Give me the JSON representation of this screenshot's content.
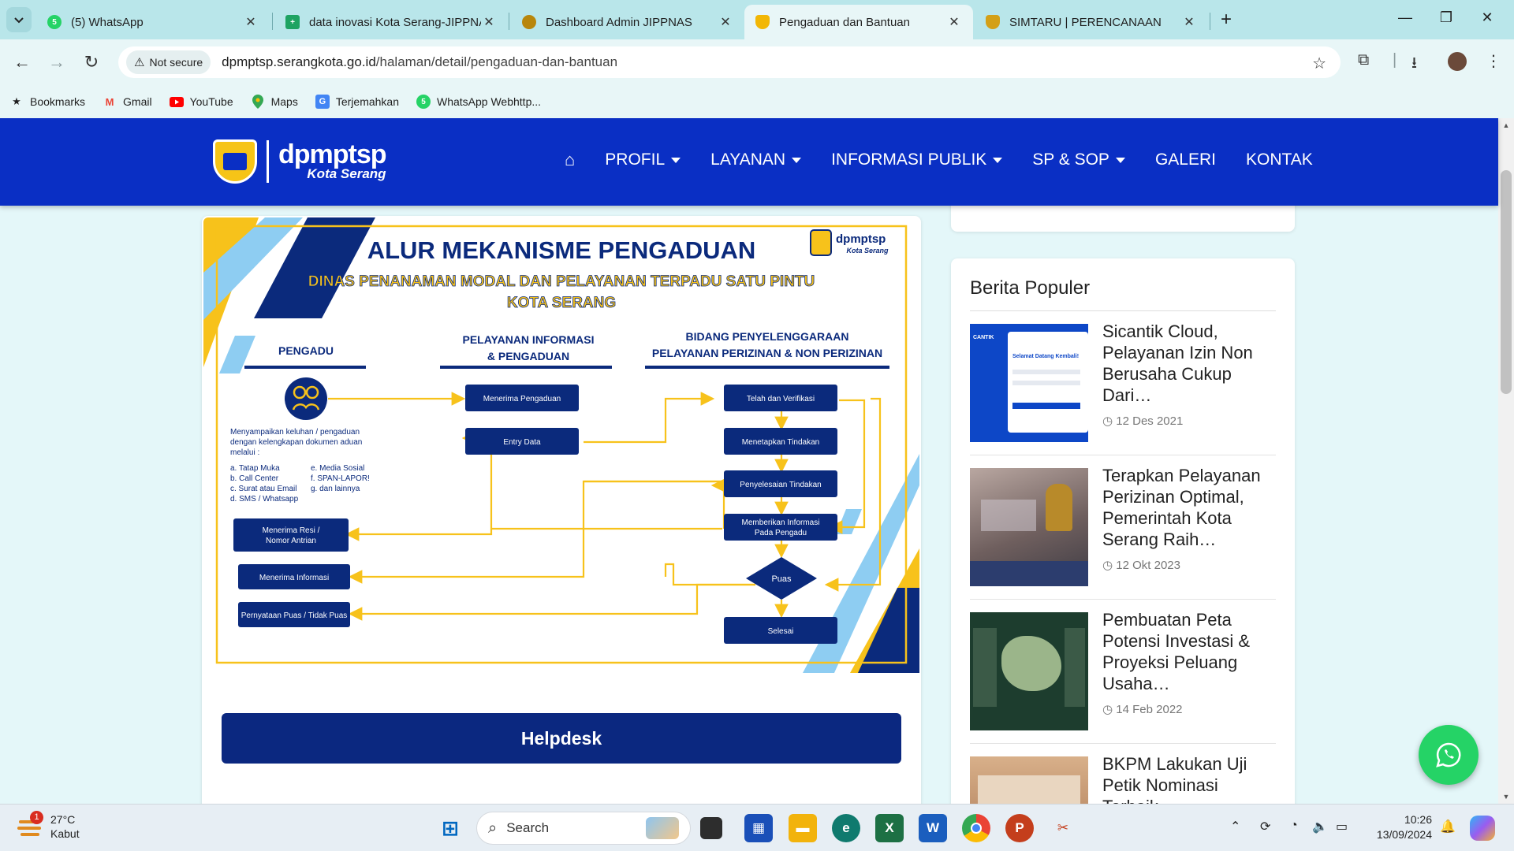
{
  "browser": {
    "tabs": [
      {
        "title": "(5) WhatsApp",
        "favicon": "whatsapp-icon",
        "color": "#25d366",
        "badge": "5"
      },
      {
        "title": "data inovasi Kota Serang-JIPPNAS",
        "favicon": "sheets-icon",
        "color": "#1ea362",
        "badge": "+"
      },
      {
        "title": "Dashboard Admin JIPPNAS",
        "favicon": "garuda-icon",
        "color": "#b8860b",
        "badge": ""
      },
      {
        "title": "Pengaduan dan Bantuan",
        "favicon": "dpmptsp-icon",
        "color": "#f2b705",
        "badge": ""
      },
      {
        "title": "SIMTARU | PERENCANAAN",
        "favicon": "simtaru-icon",
        "color": "#d4a017",
        "badge": ""
      }
    ],
    "active_tab": 3,
    "security_label": "Not secure",
    "url_domain": "dpmptsp.serangkota.go.id",
    "url_path": "/halaman/detail/pengaduan-dan-bantuan",
    "bookmarks": [
      {
        "label": "Bookmarks",
        "icon": "star-icon"
      },
      {
        "label": "Gmail",
        "icon": "gmail-icon"
      },
      {
        "label": "YouTube",
        "icon": "youtube-icon"
      },
      {
        "label": "Maps",
        "icon": "maps-icon"
      },
      {
        "label": "Terjemahkan",
        "icon": "translate-icon"
      },
      {
        "label": "WhatsApp Webhttp...",
        "icon": "whatsapp-icon"
      }
    ]
  },
  "site": {
    "logo_main": "dpmptsp",
    "logo_sub": "Kota Serang",
    "menu": [
      {
        "label": "PROFIL",
        "dropdown": true
      },
      {
        "label": "LAYANAN",
        "dropdown": true
      },
      {
        "label": "INFORMASI PUBLIK",
        "dropdown": true
      },
      {
        "label": "SP & SOP",
        "dropdown": true
      },
      {
        "label": "GALERI",
        "dropdown": false
      },
      {
        "label": "KONTAK",
        "dropdown": false
      }
    ],
    "brand_color": "#0a2fc4"
  },
  "infographic": {
    "title": "ALUR MEKANISME PENGADUAN",
    "subtitle1": "DINAS PENANAMAN MODAL DAN PELAYANAN TERPADU SATU PINTU",
    "subtitle2": "KOTA SERANG",
    "logo_main": "dpmptsp",
    "logo_sub": "Kota Serang",
    "col1": "PENGADU",
    "col2a": "PELAYANAN INFORMASI",
    "col2b": "& PENGADUAN",
    "col3a": "BIDANG PENYELENGGARAAN",
    "col3b": "PELAYANAN PERIZINAN & NON PERIZINAN",
    "desc1": "Menyampaikan keluhan / pengaduan",
    "desc2": "dengan kelengkapan dokumen aduan",
    "desc3": "melalui :",
    "ch_a": "a. Tatap Muka",
    "ch_b": "b. Call Center",
    "ch_c": "c. Surat atau Email",
    "ch_d": "d. SMS / Whatsapp",
    "ch_e": "e. Media Sosial",
    "ch_f": "f. SPAN-LAPOR!",
    "ch_g": "g. dan lainnya",
    "box_resi1": "Menerima Resi /",
    "box_resi2": "Nomor Antrian",
    "box_info": "Menerima Informasi",
    "box_puas": "Pernyataan Puas / Tidak Puas",
    "box_terima": "Menerima Pengaduan",
    "box_entry": "Entry Data",
    "box_telah": "Telah dan Verifikasi",
    "box_tetap": "Menetapkan Tindakan",
    "box_selesai_t": "Penyelesaian Tindakan",
    "box_beri1": "Memberikan Informasi",
    "box_beri2": "Pada Pengadu",
    "diamond": "Puas",
    "box_end": "Selesai"
  },
  "helpdesk_label": "Helpdesk",
  "sidebar": {
    "title": "Berita Populer",
    "items": [
      {
        "title": "Sicantik Cloud, Pelayanan Izin Non Berusaha Cukup Dari…",
        "date": "12 Des 2021"
      },
      {
        "title": "Terapkan Pelayanan Perizinan Optimal, Pemerintah Kota Serang Raih…",
        "date": "12 Okt 2023"
      },
      {
        "title": "Pembuatan Peta Potensi Investasi & Proyeksi Peluang Usaha…",
        "date": "14 Feb 2022"
      },
      {
        "title": "BKPM Lakukan Uji Petik Nominasi Terbaik…",
        "date": ""
      }
    ],
    "thumb1_caption": "Selamat Datang Kembali!",
    "thumb1_brand": "CANTIK"
  },
  "taskbar": {
    "temp": "27°C",
    "weather": "Kabut",
    "weather_badge": "1",
    "search_placeholder": "Search",
    "time": "10:26",
    "date": "13/09/2024"
  }
}
